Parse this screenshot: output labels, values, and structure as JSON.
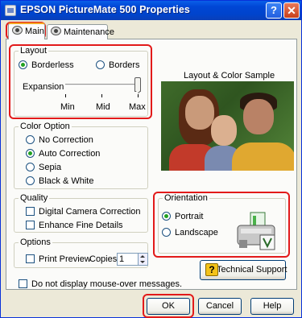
{
  "window": {
    "title": "EPSON PictureMate 500 Properties",
    "help_glyph": "?",
    "close_glyph": "✕"
  },
  "tabs": [
    {
      "label": "Main",
      "icon": "printer-settings-icon",
      "selected": true
    },
    {
      "label": "Maintenance",
      "icon": "maintenance-icon",
      "selected": false
    }
  ],
  "layout": {
    "group_title": "Layout",
    "borderless_label": "Borderless",
    "borders_label": "Borders",
    "selected": "Borderless",
    "expansion_label": "Expansion",
    "slider_min": "Min",
    "slider_mid": "Mid",
    "slider_max": "Max",
    "expansion_level": "Max"
  },
  "sample": {
    "title": "Layout & Color Sample"
  },
  "color_option": {
    "group_title": "Color Option",
    "options": [
      "No Correction",
      "Auto Correction",
      "Sepia",
      "Black & White"
    ],
    "selected": "Auto Correction"
  },
  "quality": {
    "group_title": "Quality",
    "digital_camera_correction": "Digital Camera Correction",
    "enhance_fine_details": "Enhance Fine Details"
  },
  "options": {
    "group_title": "Options",
    "print_preview": "Print Preview",
    "copies_label": "Copies",
    "copies_value": "1"
  },
  "orientation": {
    "group_title": "Orientation",
    "portrait": "Portrait",
    "landscape": "Landscape",
    "selected": "Portrait"
  },
  "support_button": "Technical Support",
  "mouseover_checkbox": "Do not display mouse-over messages.",
  "buttons": {
    "ok": "OK",
    "cancel": "Cancel",
    "help": "Help"
  },
  "colors": {
    "callout": "#e21a1a",
    "titlebar": "#0046d5",
    "radio_selected": "#21a121"
  }
}
